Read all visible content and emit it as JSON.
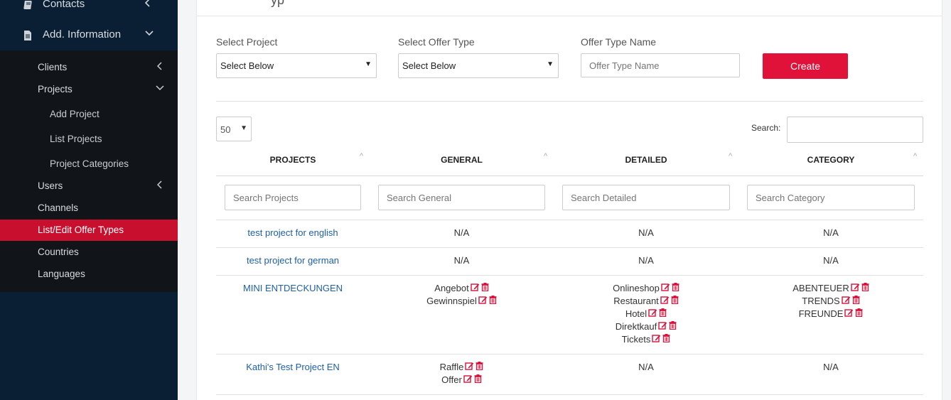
{
  "sidebar": {
    "top_items": [
      {
        "label": "Contacts",
        "icon": "book-icon"
      },
      {
        "label": "Add. Information",
        "icon": "file-icon"
      }
    ],
    "sub_items": [
      {
        "label": "Clients"
      },
      {
        "label": "Projects"
      },
      {
        "label": "Add Project"
      },
      {
        "label": "List Projects"
      },
      {
        "label": "Project Categories"
      },
      {
        "label": "Users"
      },
      {
        "label": "Channels"
      },
      {
        "label": "List/Edit Offer Types"
      },
      {
        "label": "Countries"
      },
      {
        "label": "Languages"
      }
    ],
    "active_item": "List/Edit Offer Types",
    "accent_color": "#c8102e"
  },
  "panel": {
    "title_fragment": "yp"
  },
  "form": {
    "project_label": "Select Project",
    "project_value": "Select Below",
    "offer_type_label": "Select Offer Type",
    "offer_type_value": "Select Below",
    "name_label": "Offer Type Name",
    "name_placeholder": "Offer Type Name",
    "create_label": "Create",
    "create_color": "#e0123a"
  },
  "table": {
    "page_length": "50",
    "search_label": "Search:",
    "headers": [
      "PROJECTS",
      "GENERAL",
      "DETAILED",
      "CATEGORY"
    ],
    "filters": [
      "Search Projects",
      "Search General",
      "Search Detailed",
      "Search Category"
    ],
    "rows": [
      {
        "project": "test project for english",
        "general": [
          "N/A"
        ],
        "detailed": [
          "N/A"
        ],
        "category": [
          "N/A"
        ]
      },
      {
        "project": "test project for german",
        "general": [
          "N/A"
        ],
        "detailed": [
          "N/A"
        ],
        "category": [
          "N/A"
        ]
      },
      {
        "project": "MINI ENTDECKUNGEN",
        "general": [
          "Angebot",
          "Gewinnspiel"
        ],
        "detailed": [
          "Onlineshop",
          "Restaurant",
          "Hotel",
          "Direktkauf",
          "Tickets"
        ],
        "category": [
          "ABENTEUER",
          "TRENDS",
          "FREUNDE"
        ]
      },
      {
        "project": "Kathi's Test Project EN",
        "general": [
          "Raffle",
          "Offer"
        ],
        "detailed": [
          "N/A"
        ],
        "category": [
          "N/A"
        ]
      }
    ]
  }
}
